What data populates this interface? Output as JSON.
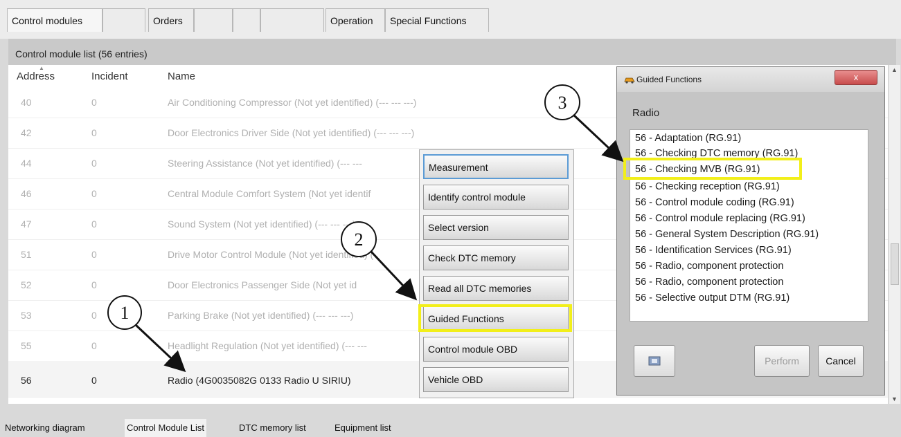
{
  "top_tabs": [
    {
      "label": "Control modules",
      "state": "active"
    },
    {
      "label": "",
      "state": "disabled"
    },
    {
      "label": "Orders",
      "state": "normal"
    },
    {
      "label": "",
      "state": "disabled"
    },
    {
      "label": "",
      "state": "disabled"
    },
    {
      "label": "",
      "state": "disabled"
    },
    {
      "label": "Operation",
      "state": "normal"
    },
    {
      "label": "Special Functions",
      "state": "normal"
    }
  ],
  "section_title": "Control module list (56 entries)",
  "columns": {
    "address": "Address",
    "incident": "Incident",
    "name": "Name"
  },
  "rows": [
    {
      "address": "40",
      "incident": "0",
      "name": "Air Conditioning Compressor (Not yet identified) (---   ---   ---)"
    },
    {
      "address": "42",
      "incident": "0",
      "name": "Door Electronics Driver Side (Not yet identified) (---   ---   ---)"
    },
    {
      "address": "44",
      "incident": "0",
      "name": "Steering Assistance (Not yet identified) (---   ---"
    },
    {
      "address": "46",
      "incident": "0",
      "name": "Central Module Comfort System (Not yet identif"
    },
    {
      "address": "47",
      "incident": "0",
      "name": "Sound System (Not yet identified) (---   ---   ---)"
    },
    {
      "address": "51",
      "incident": "0",
      "name": "Drive Motor Control Module (Not yet identified) ("
    },
    {
      "address": "52",
      "incident": "0",
      "name": "Door Electronics Passenger Side (Not yet id"
    },
    {
      "address": "53",
      "incident": "0",
      "name": "Parking Brake (Not yet identified) (---   ---   ---)"
    },
    {
      "address": "55",
      "incident": "0",
      "name": "Headlight Regulation (Not yet identified) (---   ---"
    },
    {
      "address": "56",
      "incident": "0",
      "name": "Radio (4G0035082G    0133   Radio U SIRIU)",
      "selected": true
    }
  ],
  "context_menu": [
    "Measurement",
    "Identify control module",
    "Select version",
    "Check DTC memory",
    "Read all DTC memories",
    "Guided Functions",
    "Control module OBD",
    "Vehicle OBD"
  ],
  "dialog": {
    "title": "Guided Functions",
    "close": "x",
    "heading": "Radio",
    "functions": [
      "56 - Adaptation (RG.91)",
      "56 - Checking DTC memory (RG.91)",
      "56 - Checking MVB (RG.91)",
      "56 - Checking reception (RG.91)",
      "56 - Control module coding (RG.91)",
      "56 - Control module replacing (RG.91)",
      "56 - General System Description (RG.91)",
      "56 - Identification Services (RG.91)",
      "56 - Radio, component protection",
      "56 - Radio, component protection",
      "56 - Selective output DTM (RG.91)"
    ],
    "perform": "Perform",
    "cancel": "Cancel"
  },
  "bottom_tabs": [
    "Networking diagram",
    "Control Module List",
    "DTC memory list",
    "Equipment list"
  ],
  "callouts": [
    "1",
    "2",
    "3"
  ],
  "colors": {
    "highlight": "#f2ef1a",
    "focus": "#5b9bd5",
    "close": "#c84c4c"
  }
}
